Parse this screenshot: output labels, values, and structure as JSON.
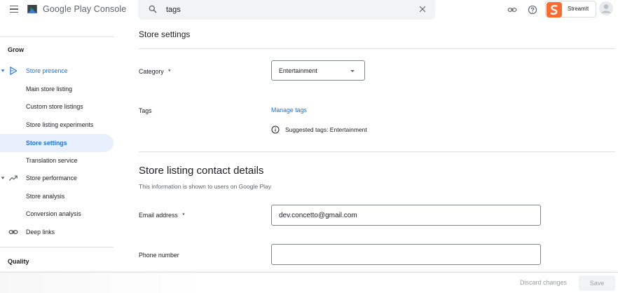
{
  "header": {
    "brand": "Google Play Console",
    "search_value": "tags",
    "app_name": "StreamIt",
    "colors": {
      "accent": "#1a73e8",
      "app_logo": "#ff6a2f"
    }
  },
  "sidebar": {
    "sections": [
      {
        "label": "Grow"
      },
      {
        "label": "Quality"
      }
    ],
    "items": [
      {
        "label": "Store presence",
        "icon": "play-arrow-outline-icon",
        "state": "expanded"
      },
      {
        "label": "Main store listing"
      },
      {
        "label": "Custom store listings"
      },
      {
        "label": "Store listing experiments"
      },
      {
        "label": "Store settings",
        "state": "selected"
      },
      {
        "label": "Translation service"
      },
      {
        "label": "Store performance",
        "icon": "trending-up-icon",
        "state": "expanded"
      },
      {
        "label": "Store analysis"
      },
      {
        "label": "Conversion analysis"
      },
      {
        "label": "Deep links",
        "icon": "link-icon"
      }
    ]
  },
  "main": {
    "store_settings": {
      "title": "Store settings",
      "category_label": "Category",
      "required_mark": "*",
      "category_value": "Entertainment",
      "tags_label": "Tags",
      "manage_tags": "Manage tags",
      "suggested_tags": "Suggested tags: Entertainment"
    },
    "contact": {
      "title": "Store listing contact details",
      "subtitle": "This information is shown to users on Google Play",
      "email_label": "Email address",
      "required_mark": "*",
      "email_value": "dev.concetto@gmail.com",
      "phone_label": "Phone number",
      "phone_value": ""
    }
  },
  "footer": {
    "discard_label": "Discard changes",
    "save_label": "Save"
  }
}
